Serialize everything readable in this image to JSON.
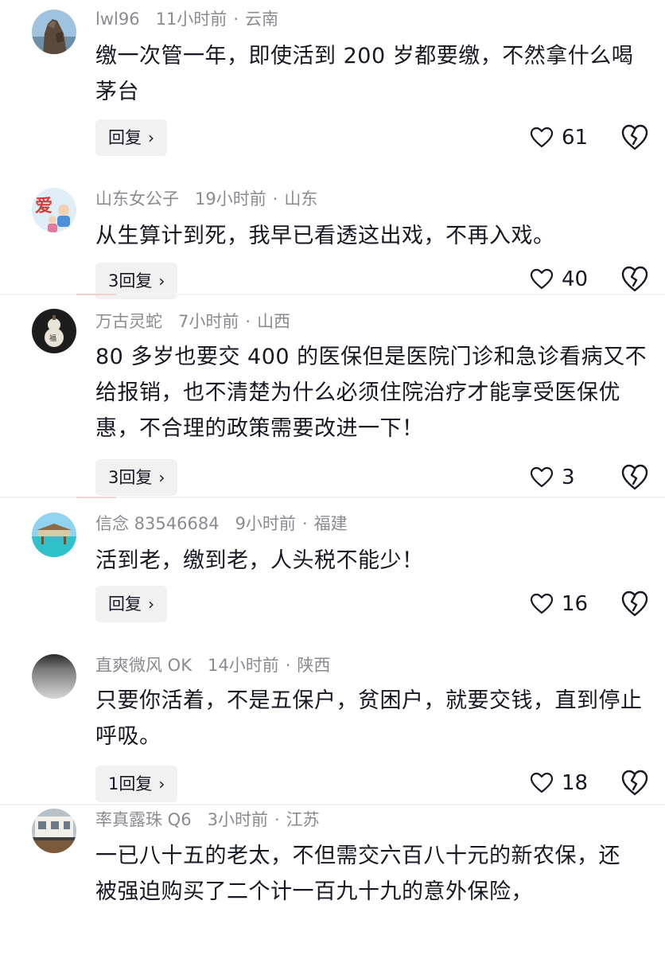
{
  "comments": [
    {
      "username": "lwl96",
      "time": "11小时前",
      "location": "云南",
      "text": "缴一次管一年，即使活到 200 岁都要缴，不然拿什么喝茅台",
      "reply_label": "回复",
      "likes": "61",
      "avatar_icon": "rock-landscape-avatar-icon"
    },
    {
      "username": "山东女公子",
      "time": "19小时前",
      "location": "山东",
      "text": "从生算计到死，我早已看透这出戏，不再入戏。",
      "reply_label": "3回复",
      "likes": "40",
      "avatar_icon": "love-cartoon-avatar-icon"
    },
    {
      "username": "万古灵蛇",
      "time": "7小时前",
      "location": "山西",
      "text": "80 多岁也要交 400 的医保但是医院门诊和急诊看病又不给报销，也不清楚为什么必须住院治疗才能享受医保优惠，不合理的政策需要改进一下！",
      "reply_label": "3回复",
      "likes": "3",
      "avatar_icon": "gourd-avatar-icon"
    },
    {
      "username": "信念 83546684",
      "time": "9小时前",
      "location": "福建",
      "text": "活到老，缴到老，人头税不能少！",
      "reply_label": "回复",
      "likes": "16",
      "avatar_icon": "beach-villa-avatar-icon"
    },
    {
      "username": "直爽微风 OK",
      "time": "14小时前",
      "location": "陕西",
      "text": "只要你活着，不是五保户，贫困户，就要交钱，直到停止呼吸。",
      "reply_label": "1回复",
      "likes": "18",
      "avatar_icon": "gray-gradient-avatar-icon"
    },
    {
      "username": "率真露珠 Q6",
      "time": "3小时前",
      "location": "江苏",
      "text": "一已八十五的老太，不但需交六百八十元的新农保，还被强迫购买了二个计一百九十九的意外保险，",
      "reply_label": "",
      "likes": "",
      "avatar_icon": "house-balcony-avatar-icon"
    }
  ],
  "ui": {
    "meta_separator": "·",
    "reply_chevron": "›"
  },
  "colors": {
    "like_outline": "#161823",
    "meta_text": "#8a8b91",
    "reply_bg": "#f1f1f2"
  }
}
